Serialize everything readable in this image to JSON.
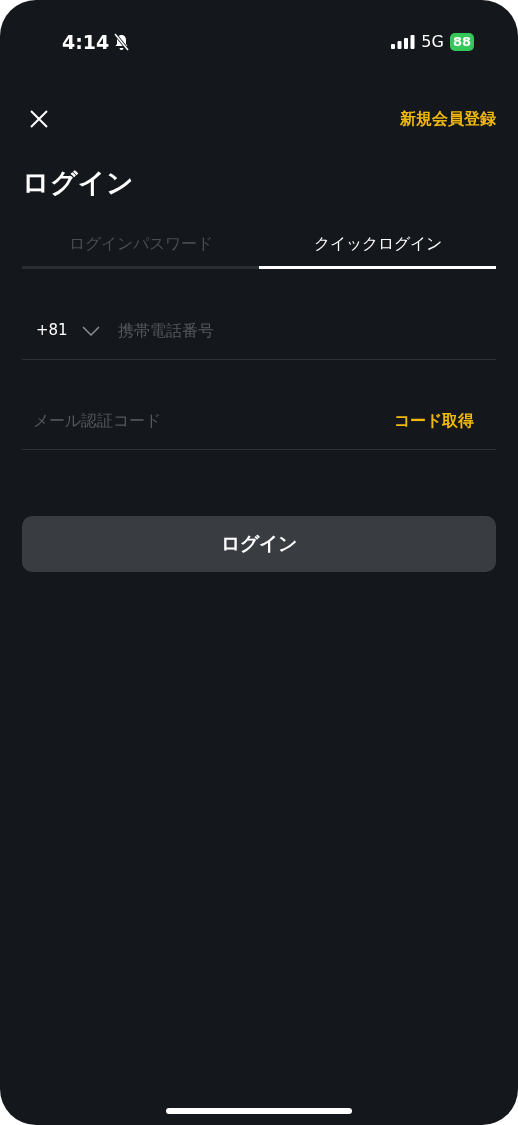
{
  "status_bar": {
    "time": "4:14",
    "network": "5G",
    "battery": "88"
  },
  "header": {
    "register_link": "新規会員登録"
  },
  "title": "ログイン",
  "tabs": [
    {
      "label": "ログインパスワード",
      "selected": false
    },
    {
      "label": "クイックログイン",
      "selected": true
    }
  ],
  "phone_field": {
    "country_code": "+81",
    "placeholder": "携帯電話番号"
  },
  "code_field": {
    "placeholder": "メール認証コード",
    "action": "コード取得"
  },
  "login_button": "ログイン"
}
